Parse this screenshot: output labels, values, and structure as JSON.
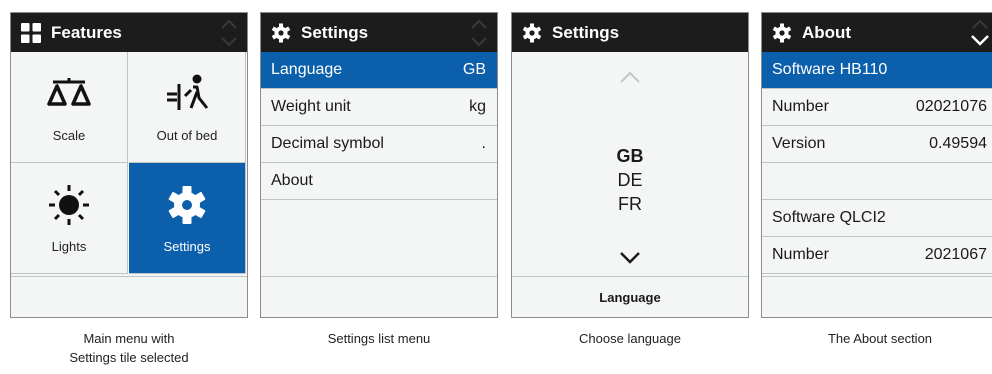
{
  "colors": {
    "header": "#1c1c1c",
    "selected": "#0b5fab",
    "background": "#f4f5f5",
    "divider": "#bfc4c6"
  },
  "panel1": {
    "title": "Features",
    "title_icon": "grid-icon",
    "tiles": [
      {
        "label": "Scale",
        "icon": "scale-icon",
        "selected": false
      },
      {
        "label": "Out of bed",
        "icon": "out-of-bed-icon",
        "selected": false
      },
      {
        "label": "Lights",
        "icon": "light-icon",
        "selected": false
      },
      {
        "label": "Settings",
        "icon": "gear-icon",
        "selected": true
      }
    ],
    "caption_line1": "Main menu with",
    "caption_line2": "Settings tile selected"
  },
  "panel2": {
    "title": "Settings",
    "title_icon": "gear-icon",
    "rows": [
      {
        "label": "Language",
        "value": "GB",
        "selected": true
      },
      {
        "label": "Weight unit",
        "value": "kg",
        "selected": false
      },
      {
        "label": "Decimal symbol",
        "value": ".",
        "selected": false
      },
      {
        "label": "About",
        "value": "",
        "selected": false
      }
    ],
    "caption": "Settings list menu"
  },
  "panel3": {
    "title": "Settings",
    "title_icon": "gear-icon",
    "options": [
      "GB",
      "DE",
      "FR"
    ],
    "current": "GB",
    "footer": "Language",
    "caption": "Choose language"
  },
  "panel4": {
    "title": "About",
    "title_icon": "gear-icon",
    "rows": [
      {
        "label": "Software HB110",
        "value": "",
        "selected": true
      },
      {
        "label": "Number",
        "value": "02021076",
        "selected": false
      },
      {
        "label": "Version",
        "value": "0.49594",
        "selected": false
      },
      {
        "label": "",
        "value": "",
        "selected": false
      },
      {
        "label": "Software QLCI2",
        "value": "",
        "selected": false
      },
      {
        "label": "Number",
        "value": "2021067",
        "selected": false
      }
    ],
    "caption": "The About section"
  }
}
